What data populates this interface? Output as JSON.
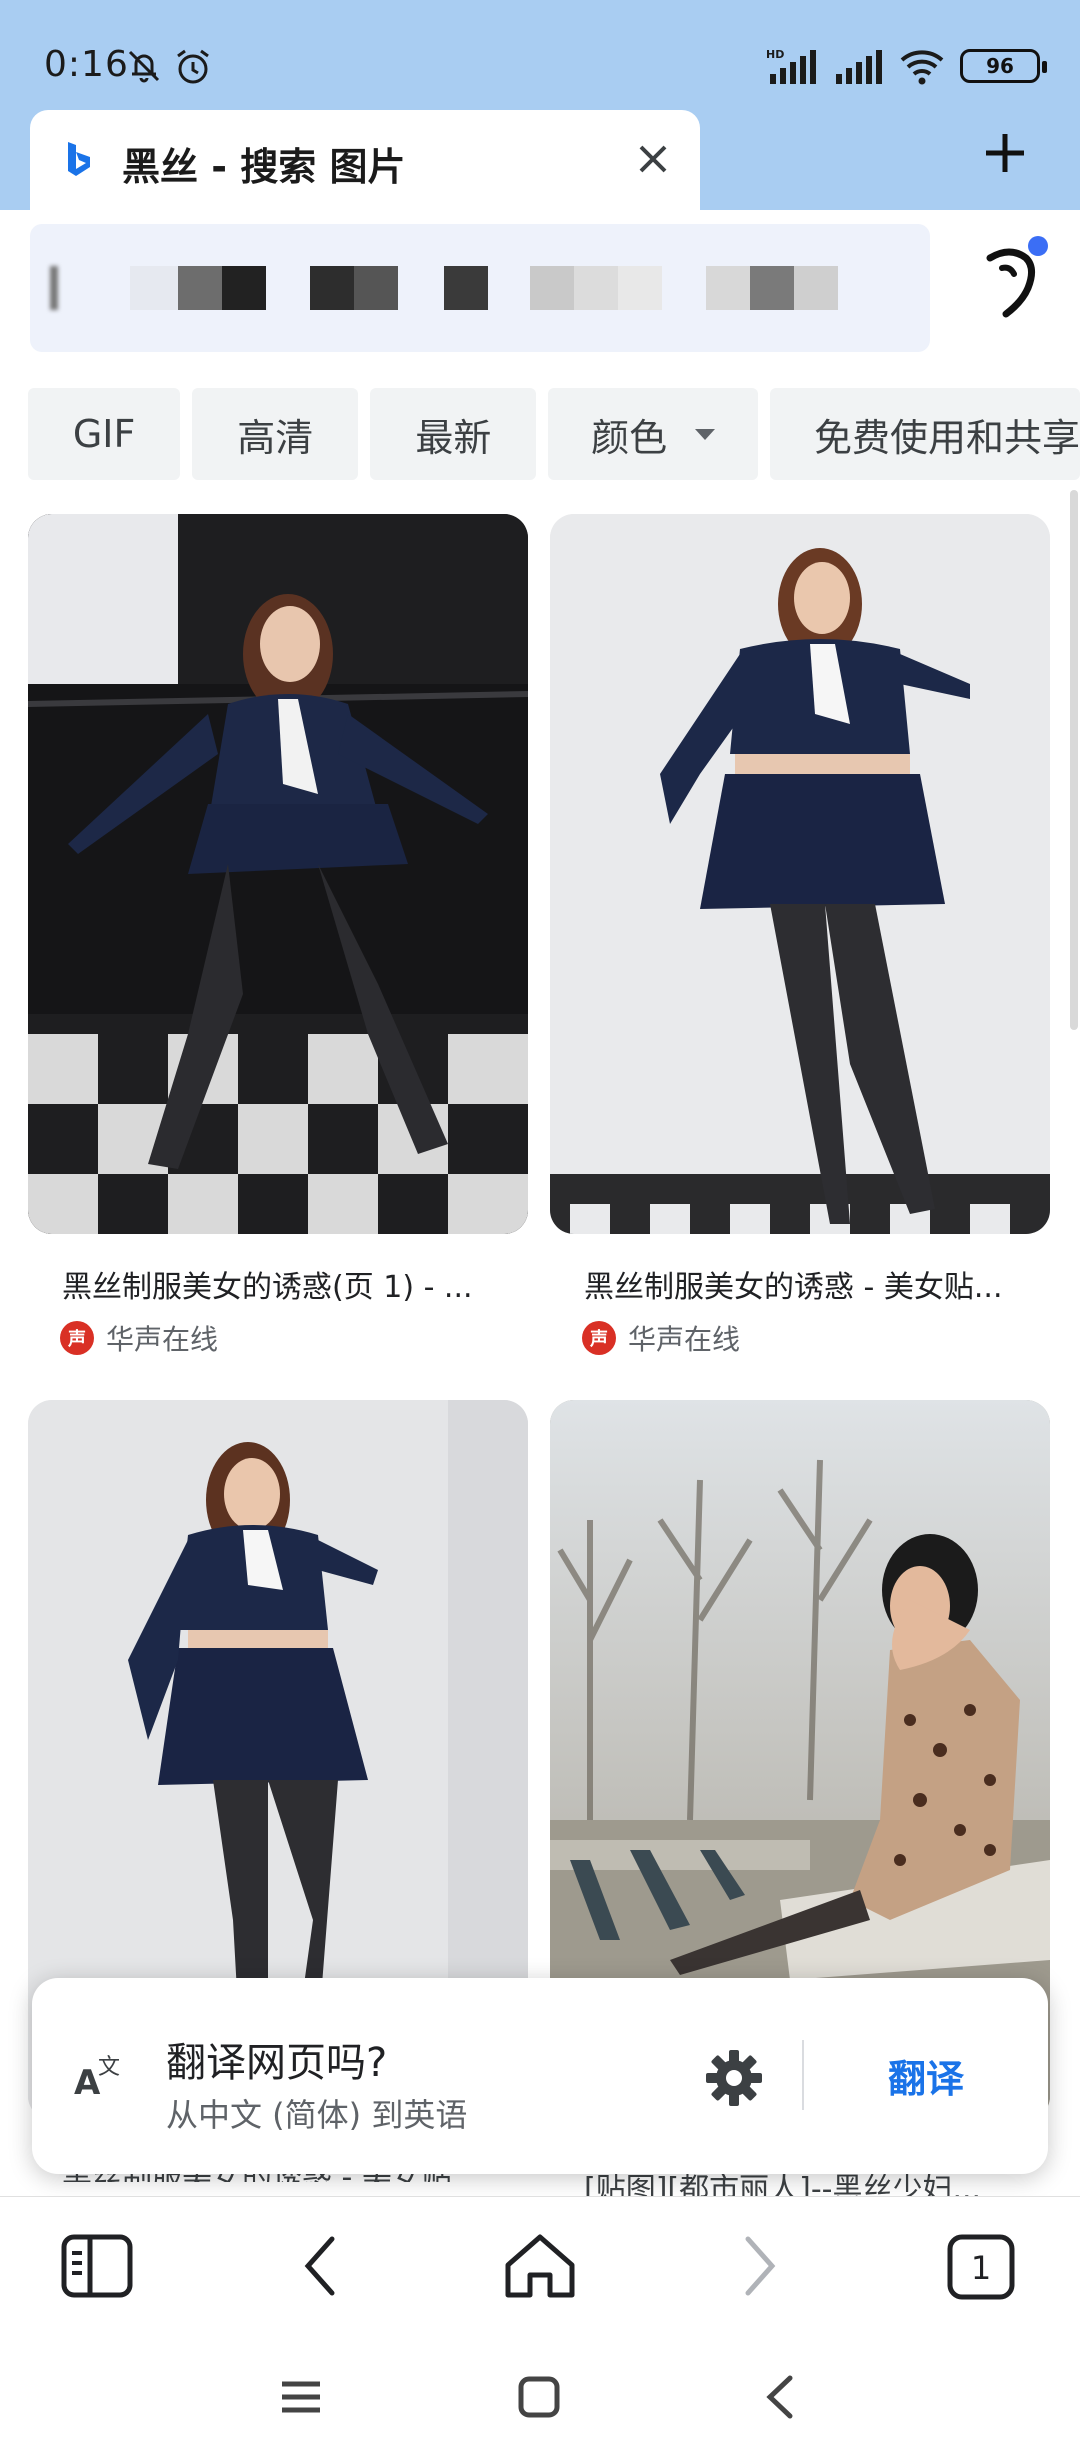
{
  "status": {
    "time": "0:16",
    "battery": "96"
  },
  "tab": {
    "title": "黑丝 - 搜索 图片"
  },
  "filters": [
    "GIF",
    "高清",
    "最新",
    "颜色",
    "免费使用和共享"
  ],
  "results": [
    {
      "caption": "黑丝制服美女的诱惑(页 1) - ...",
      "source": "华声在线"
    },
    {
      "caption": "黑丝制服美女的诱惑 - 美女贴...",
      "source": "华声在线"
    },
    {
      "caption": "黑丝制服美女的诱惑 - 美女贴...",
      "source": ""
    },
    {
      "caption": "[贴图][都市丽人]--黑丝少妇...",
      "source": ""
    }
  ],
  "translate": {
    "question": "翻译网页吗?",
    "detail": "从中文 (简体) 到英语",
    "button": "翻译"
  },
  "bottom_nav": {
    "tab_count": "1"
  }
}
